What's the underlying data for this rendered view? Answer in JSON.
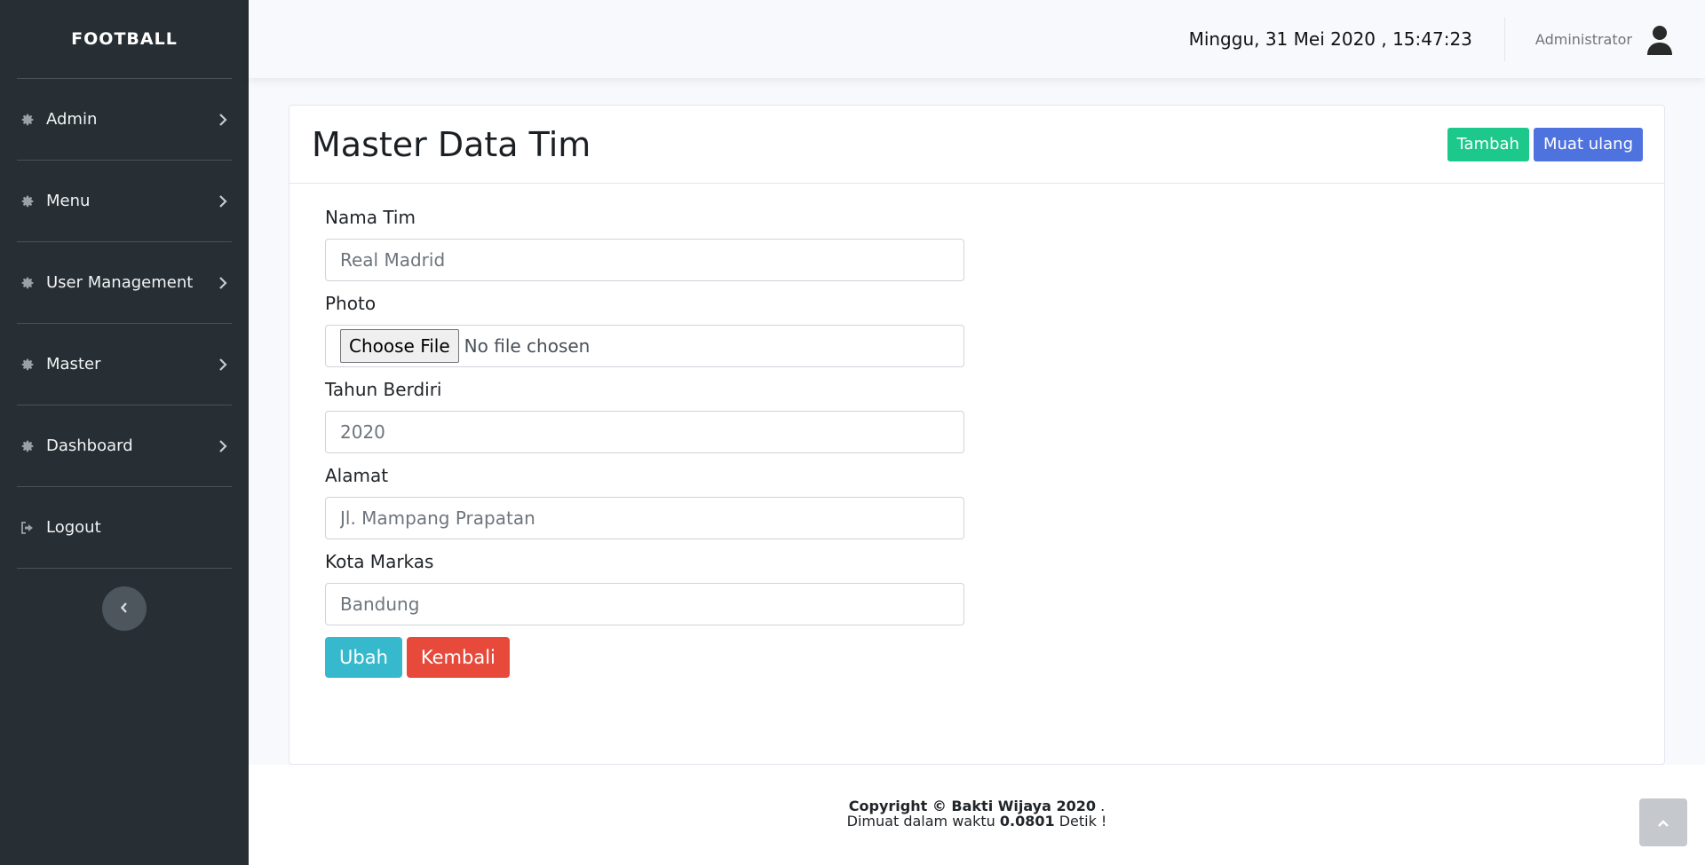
{
  "brand": "FOOTBALL",
  "sidebar": {
    "items": [
      {
        "label": "Admin",
        "icon": "gear-icon"
      },
      {
        "label": "Menu",
        "icon": "gear-icon"
      },
      {
        "label": "User Management",
        "icon": "gear-icon"
      },
      {
        "label": "Master",
        "icon": "gear-icon"
      },
      {
        "label": "Dashboard",
        "icon": "gear-icon"
      },
      {
        "label": "Logout",
        "icon": "sign-out-icon"
      }
    ]
  },
  "topbar": {
    "datetime": "Minggu, 31 Mei 2020 , 15:47:23",
    "username": "Administrator"
  },
  "card": {
    "title": "Master Data Tim",
    "add_label": "Tambah",
    "reload_label": "Muat ulang"
  },
  "form": {
    "nama_tim": {
      "label": "Nama Tim",
      "placeholder": "Real Madrid"
    },
    "photo": {
      "label": "Photo",
      "button": "Choose File",
      "status": "No file chosen"
    },
    "tahun_berdiri": {
      "label": "Tahun Berdiri",
      "placeholder": "2020"
    },
    "alamat": {
      "label": "Alamat",
      "placeholder": "Jl. Mampang Prapatan"
    },
    "kota_markas": {
      "label": "Kota Markas",
      "placeholder": "Bandung"
    },
    "submit_label": "Ubah",
    "back_label": "Kembali"
  },
  "footer": {
    "copyright": "Copyright © Bakti Wijaya 2020",
    "copyright_suffix": " .",
    "load_prefix": "Dimuat dalam waktu ",
    "load_time": "0.0801",
    "load_suffix": " Detik !"
  },
  "colors": {
    "sidebar_bg": "#272f34",
    "success": "#1cc88a",
    "primary": "#4e73df",
    "info": "#36b9cc",
    "danger": "#e74a3b"
  }
}
